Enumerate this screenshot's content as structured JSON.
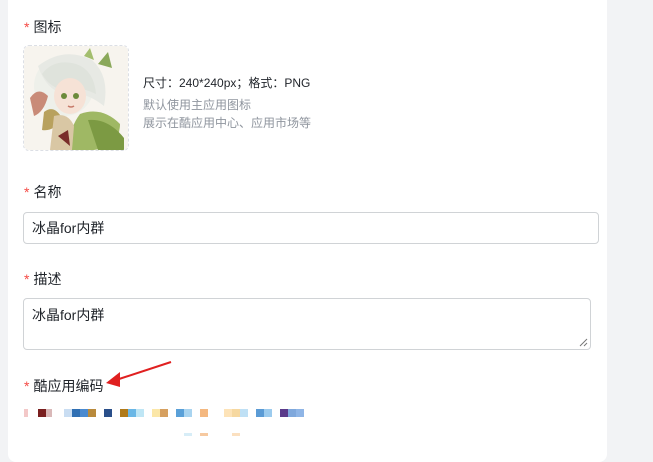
{
  "form": {
    "icon_field": {
      "required_mark": "*",
      "label": "图标",
      "hint_size": "尺寸：240*240px；格式：PNG",
      "hint_default": "默认使用主应用图标",
      "hint_display": "展示在酷应用中心、应用市场等"
    },
    "name_field": {
      "required_mark": "*",
      "label": "名称",
      "value": "冰晶for内群"
    },
    "desc_field": {
      "required_mark": "*",
      "label": "描述",
      "value": "冰晶for内群"
    },
    "code_field": {
      "required_mark": "*",
      "label": "酷应用编码"
    }
  },
  "colors": {
    "required": "#f54a45",
    "annotation_arrow": "#e02020"
  },
  "icons": [
    "app-icon-image",
    "resize-grip-icon",
    "annotation-arrow-icon"
  ]
}
